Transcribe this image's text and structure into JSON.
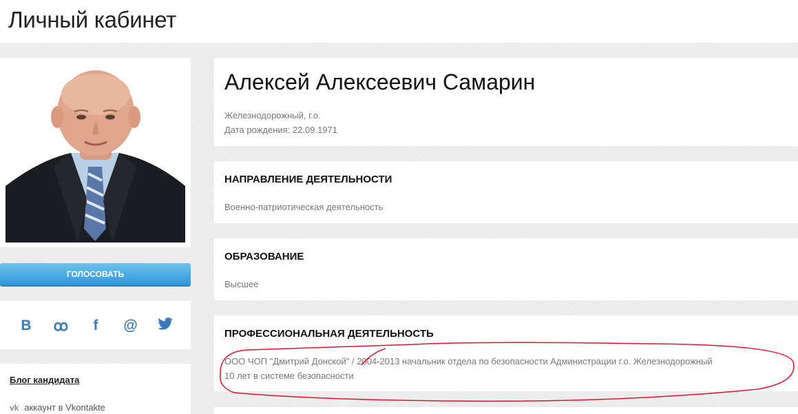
{
  "header": {
    "title": "Личный кабинет"
  },
  "candidate": {
    "name": "Алексей Алексеевич Самарин",
    "location": "Железнодорожный, г.о.",
    "birth": "Дата рождения: 22.09.1971"
  },
  "vote_button": "Голосовать",
  "social": {
    "vk": "B",
    "ok": "ꝏ",
    "fb": "f",
    "mail": "@",
    "tw": "🐦"
  },
  "blog": {
    "title": "Блог кандидата",
    "vk_account": "аккаунт в Vkontakte"
  },
  "sections": [
    {
      "title": "Направление деятельности",
      "lines": [
        "Военно-патриотическая деятельность"
      ]
    },
    {
      "title": "Образование",
      "lines": [
        "Высшее"
      ]
    },
    {
      "title": "Профессиональная деятельность",
      "lines": [
        "ООО ЧОП \"Дмитрий Донской\" / 2004-2013 начальник отдела по безопасности Администрации г.о. Железнодорожный",
        "10 лет в системе безопасности"
      ]
    }
  ],
  "colors": {
    "button": "#2f97da",
    "social": "#3a7ab8",
    "annotation": "#e0142a"
  }
}
